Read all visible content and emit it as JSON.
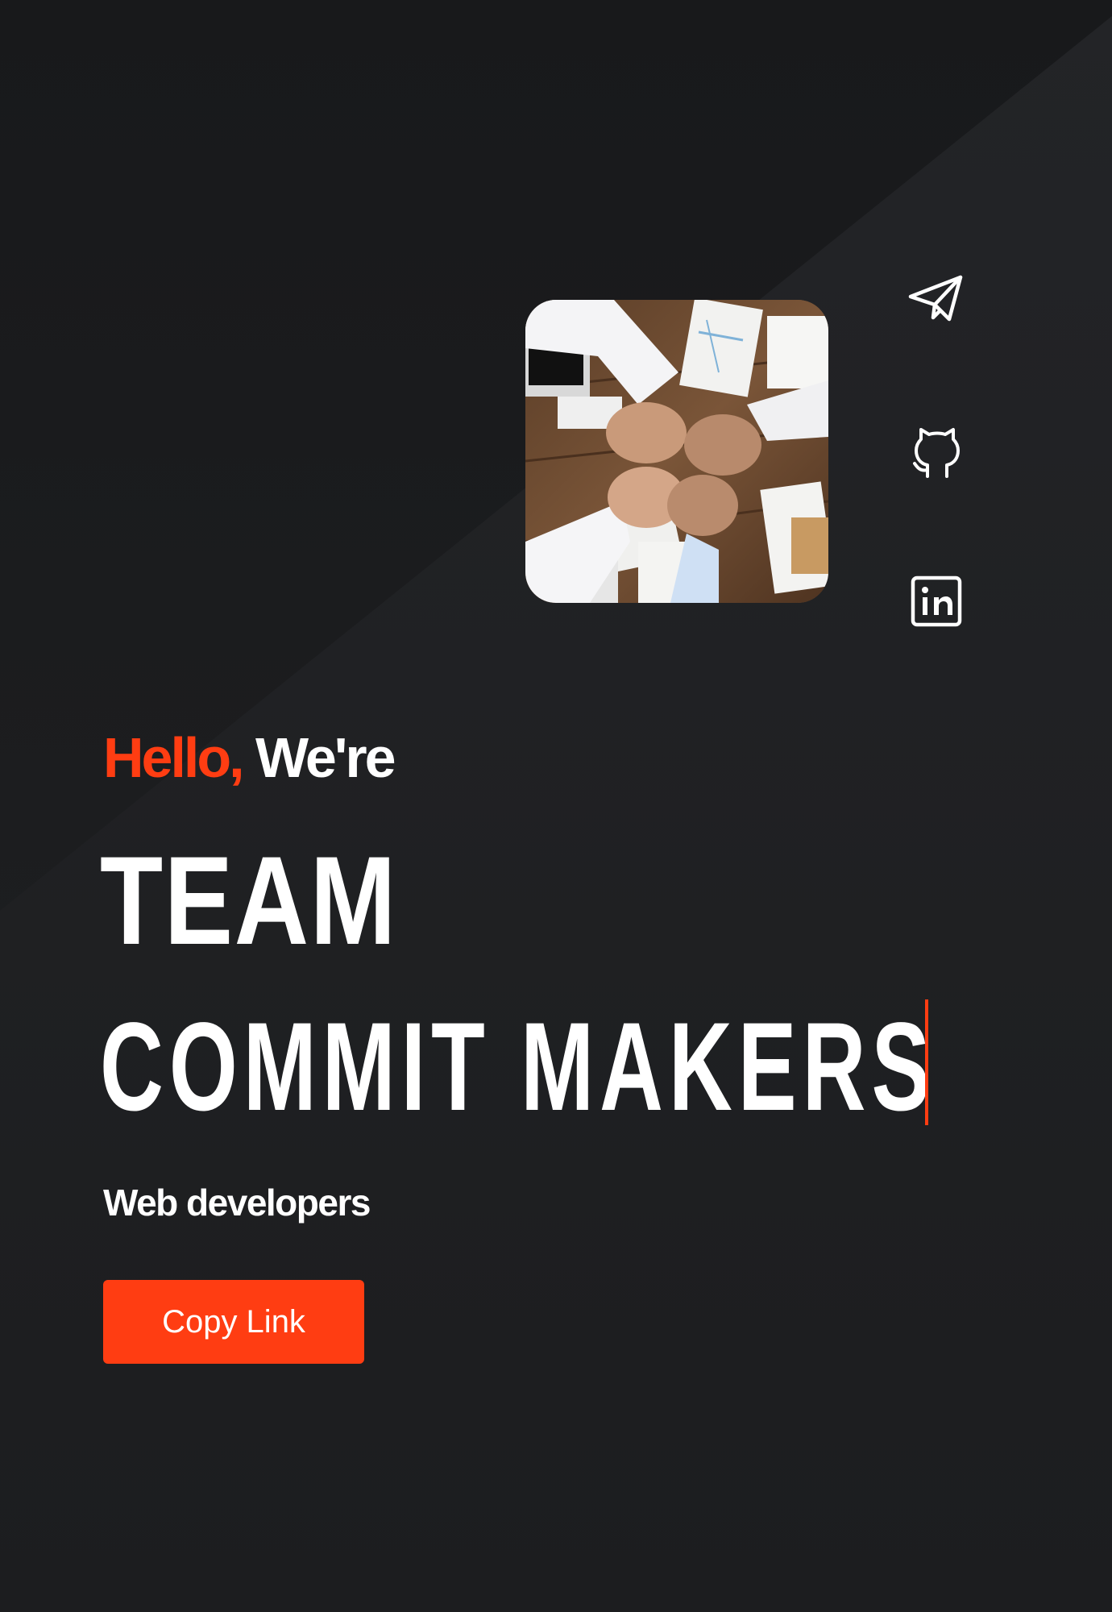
{
  "hero": {
    "greeting_accent": "Hello,",
    "greeting_rest": "We're",
    "headline_line1": "TEAM",
    "headline_line2": "COMMIT MAKERS",
    "subtitle": "Web developers",
    "copy_button_label": "Copy Link"
  },
  "social": [
    {
      "name": "telegram",
      "icon": "paper-plane-icon"
    },
    {
      "name": "github",
      "icon": "github-cat-icon"
    },
    {
      "name": "linkedin",
      "icon": "linkedin-icon"
    }
  ],
  "colors": {
    "accent": "#ff3d12",
    "background": "#1d1e20",
    "text": "#ffffff"
  }
}
